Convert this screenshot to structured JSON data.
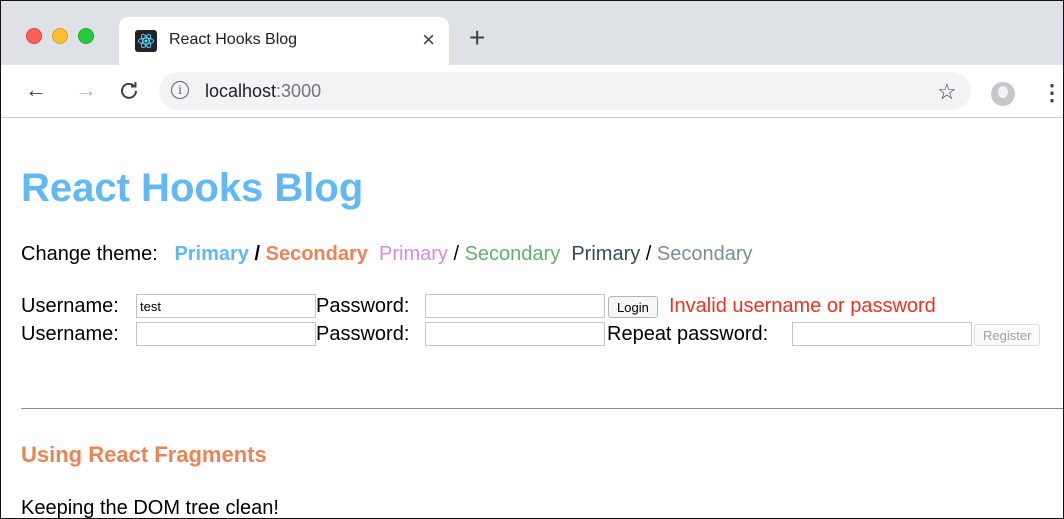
{
  "browser": {
    "tab": {
      "title": "React Hooks Blog",
      "close": "×"
    },
    "new_tab": "+",
    "nav": {
      "back": "←",
      "forward": "→",
      "reload": "C"
    },
    "url": {
      "host": "localhost",
      "port": ":3000"
    },
    "icons": {
      "info": "i",
      "star": "☆",
      "menu": "⋮"
    }
  },
  "page": {
    "title": "React Hooks Blog",
    "theme": {
      "label": "Change theme:",
      "separator": "/",
      "options": [
        {
          "primary": "Primary",
          "secondary": "Secondary",
          "primary_color": "#61b8f3",
          "secondary_color": "#ec8356"
        },
        {
          "primary": "Primary",
          "secondary": "Secondary",
          "primary_color": "#d68ae1",
          "secondary_color": "#5fb26f"
        },
        {
          "primary": "Primary",
          "secondary": "Secondary",
          "primary_color": "#3a4a59",
          "secondary_color": "#7c8c9a"
        }
      ]
    },
    "login": {
      "username_label": "Username:",
      "username_value": "test",
      "password_label": "Password:",
      "password_value": "",
      "button": "Login",
      "error": "Invalid username or password"
    },
    "register": {
      "username_label": "Username:",
      "username_value": "",
      "password_label": "Password:",
      "password_value": "",
      "repeat_label": "Repeat password:",
      "repeat_value": "",
      "button": "Register"
    },
    "post": {
      "title": "Using React Fragments",
      "content": "Keeping the DOM tree clean!"
    }
  }
}
